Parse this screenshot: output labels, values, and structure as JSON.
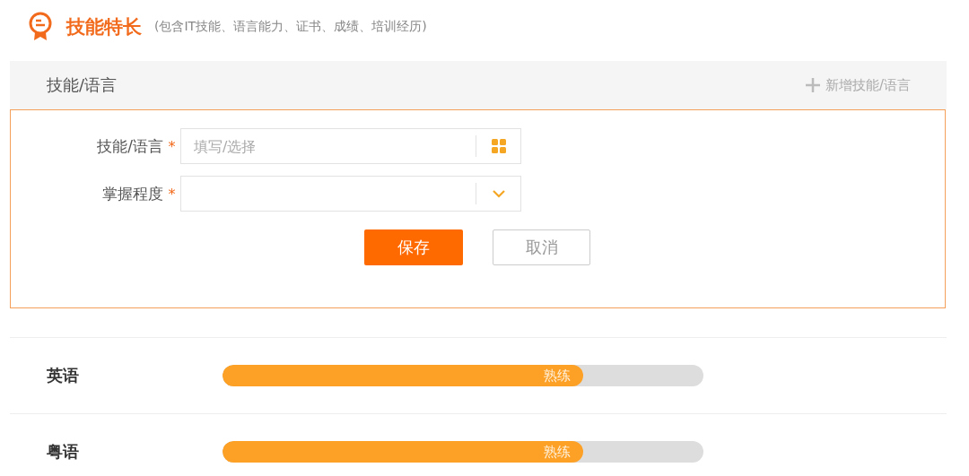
{
  "header": {
    "title": "技能特长",
    "subtitle": "(包含IT技能、语言能力、证书、成绩、培训经历)"
  },
  "section": {
    "title": "技能/语言",
    "add_button": "新增技能/语言"
  },
  "form": {
    "fields": [
      {
        "kind": "picker",
        "label": "技能/语言",
        "required_mark": "*",
        "placeholder": "填写/选择"
      },
      {
        "kind": "select",
        "label": "掌握程度",
        "required_mark": "*"
      }
    ],
    "save": "保存",
    "cancel": "取消"
  },
  "skills": [
    {
      "name": "英语",
      "level": 0.75,
      "reading": "熟练"
    },
    {
      "name": "粤语",
      "level": 0.75,
      "reading": "熟练"
    }
  ]
}
